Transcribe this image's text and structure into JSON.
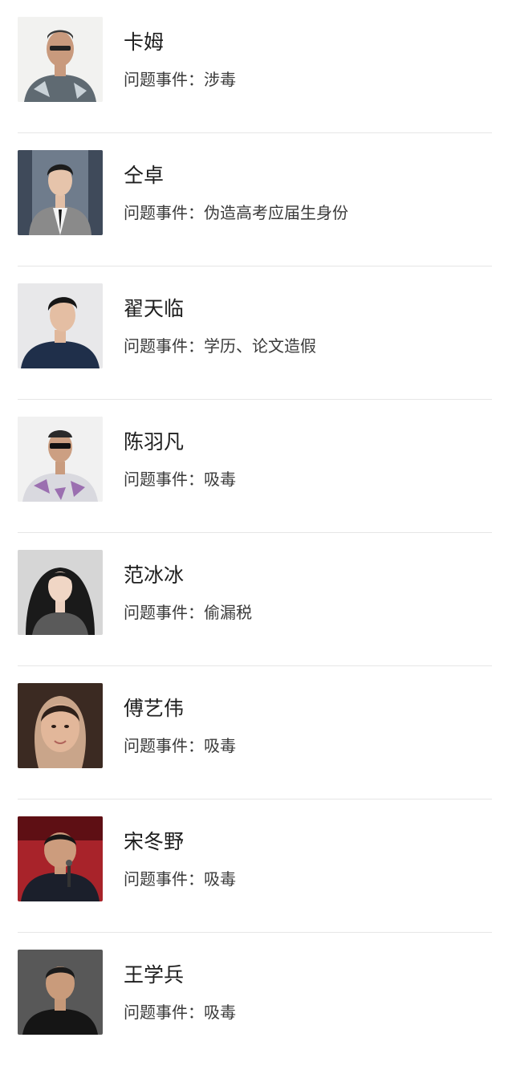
{
  "list": {
    "issue_prefix": "问题事件：",
    "items": [
      {
        "name": "卡姆",
        "issue": "涉毒",
        "avatar_icon": "person-photo"
      },
      {
        "name": "仝卓",
        "issue": "伪造高考应届生身份",
        "avatar_icon": "person-photo"
      },
      {
        "name": "翟天临",
        "issue": "学历、论文造假",
        "avatar_icon": "person-photo"
      },
      {
        "name": "陈羽凡",
        "issue": "吸毒",
        "avatar_icon": "person-photo"
      },
      {
        "name": "范冰冰",
        "issue": "偷漏税",
        "avatar_icon": "person-photo"
      },
      {
        "name": "傅艺伟",
        "issue": "吸毒",
        "avatar_icon": "person-photo"
      },
      {
        "name": "宋冬野",
        "issue": "吸毒",
        "avatar_icon": "person-photo"
      },
      {
        "name": "王学兵",
        "issue": "吸毒",
        "avatar_icon": "person-photo"
      }
    ]
  }
}
